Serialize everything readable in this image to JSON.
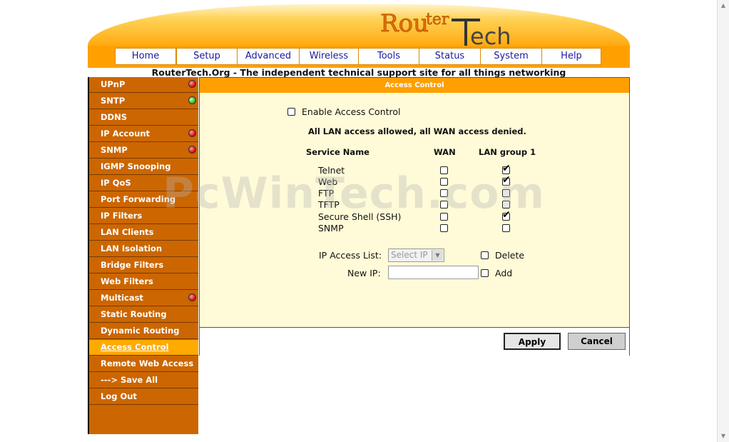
{
  "brand": {
    "logo_part1": "Rou",
    "logo_part2": "ter",
    "logo_part3": "ech"
  },
  "nav": [
    {
      "label": "Home"
    },
    {
      "label": "Setup"
    },
    {
      "label": "Advanced"
    },
    {
      "label": "Wireless"
    },
    {
      "label": "Tools"
    },
    {
      "label": "Status"
    },
    {
      "label": "System"
    },
    {
      "label": "Help"
    }
  ],
  "tagline": "RouterTech.Org - The independent technical support site for all things networking",
  "sidebar": [
    {
      "label": "UPnP",
      "status": "red"
    },
    {
      "label": "SNTP",
      "status": "green"
    },
    {
      "label": "DDNS",
      "status": ""
    },
    {
      "label": "IP Account",
      "status": "red"
    },
    {
      "label": "SNMP",
      "status": "red"
    },
    {
      "label": "IGMP Snooping",
      "status": ""
    },
    {
      "label": "IP QoS",
      "status": ""
    },
    {
      "label": "Port Forwarding",
      "status": ""
    },
    {
      "label": "IP Filters",
      "status": ""
    },
    {
      "label": "LAN Clients",
      "status": ""
    },
    {
      "label": "LAN Isolation",
      "status": ""
    },
    {
      "label": "Bridge Filters",
      "status": ""
    },
    {
      "label": "Web Filters",
      "status": ""
    },
    {
      "label": "Multicast",
      "status": "red"
    },
    {
      "label": "Static Routing",
      "status": ""
    },
    {
      "label": "Dynamic Routing",
      "status": ""
    },
    {
      "label": "Access Control",
      "status": "",
      "active": true
    },
    {
      "label": "Remote Web Access",
      "status": ""
    },
    {
      "label": "---> Save All",
      "status": ""
    },
    {
      "label": "Log Out",
      "status": ""
    }
  ],
  "panel": {
    "title": "Access Control",
    "enable_label": "Enable Access Control",
    "enable_checked": false,
    "summary": "All LAN access allowed, all WAN access denied.",
    "col_service": "Service Name",
    "col_wan": "WAN",
    "col_lan": "LAN group 1",
    "services": [
      {
        "name": "Telnet",
        "wan": false,
        "lan": true
      },
      {
        "name": "Web",
        "wan": false,
        "lan": true
      },
      {
        "name": "FTP",
        "wan": false,
        "lan": false
      },
      {
        "name": "TFTP",
        "wan": false,
        "lan": false
      },
      {
        "name": "Secure Shell (SSH)",
        "wan": false,
        "lan": true
      },
      {
        "name": "SNMP",
        "wan": false,
        "lan": false
      }
    ],
    "ip_list_label": "IP Access List:",
    "ip_list_value": "Select IP",
    "delete_label": "Delete",
    "new_ip_label": "New IP:",
    "new_ip_value": "",
    "add_label": "Add",
    "apply_label": "Apply",
    "cancel_label": "Cancel"
  },
  "watermark": "PcWinTech.com",
  "colors": {
    "accent": "#ffa000",
    "sidebar": "#cc6600",
    "panel_bg": "#fffbd8",
    "nav_text": "#1a1aa0"
  }
}
